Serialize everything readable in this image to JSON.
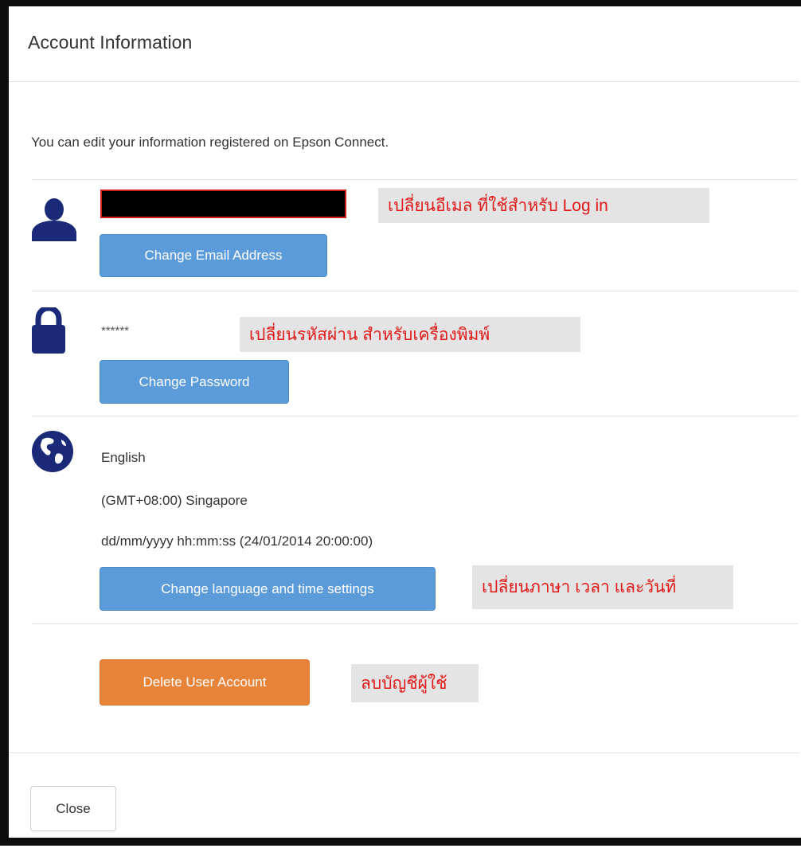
{
  "dialog": {
    "title": "Account Information",
    "intro": "You can edit your information registered on Epson Connect."
  },
  "email_section": {
    "icon": "user-icon",
    "button_label": "Change Email Address",
    "note": "เปลี่ยนอีเมล  ที่ใช้สำหรับ Log in"
  },
  "password_section": {
    "icon": "lock-icon",
    "masked_password": "******",
    "button_label": "Change Password",
    "note": "เปลี่ยนรหัสผ่าน สำหรับเครื่องพิมพ์"
  },
  "language_section": {
    "icon": "globe-icon",
    "language": "English",
    "timezone": "(GMT+08:00) Singapore",
    "datetime_format": "dd/mm/yyyy hh:mm:ss (24/01/2014 20:00:00)",
    "button_label": "Change language and time settings",
    "note": "เปลี่ยนภาษา เวลา และวันที่"
  },
  "delete_section": {
    "button_label": "Delete User Account",
    "note": "ลบบัญชีผู้ใช้"
  },
  "footer": {
    "close_label": "Close"
  },
  "colors": {
    "icon_navy": "#1a2a78",
    "primary_button": "#5b9bd9",
    "danger_button": "#e7843a",
    "note_text": "#e01818",
    "note_background": "#e4e4e4"
  }
}
